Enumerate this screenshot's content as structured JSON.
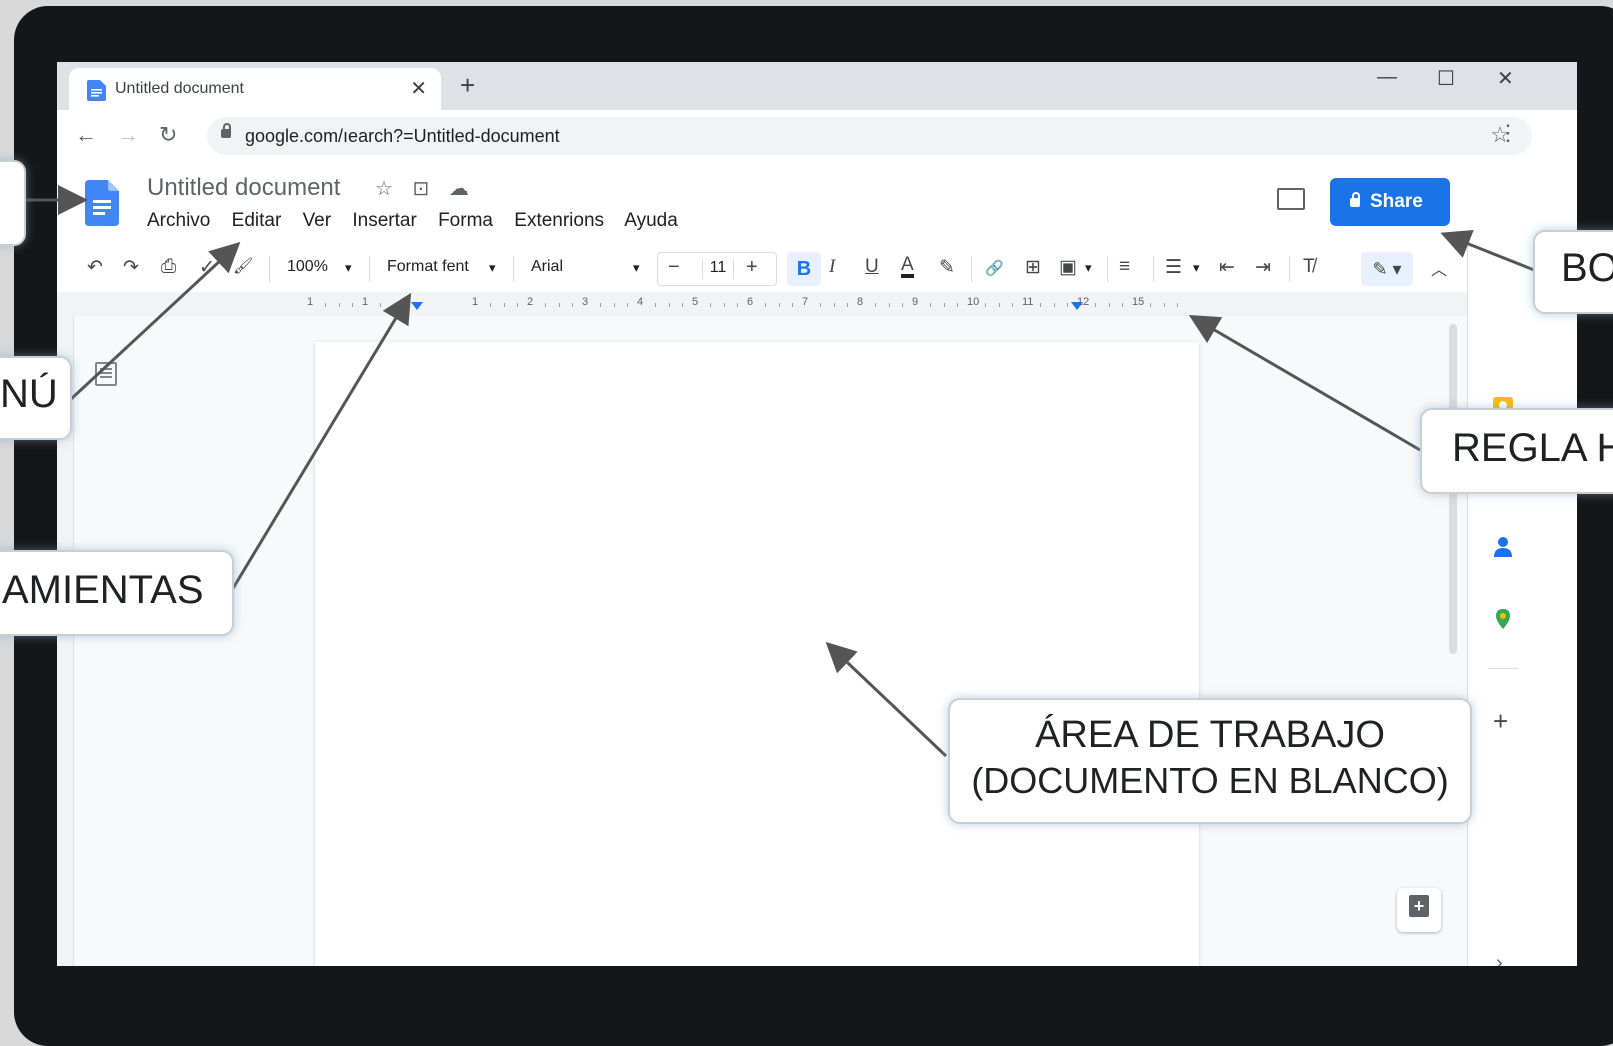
{
  "browser": {
    "tab_title": "Untitled document",
    "tab_close": "✕",
    "new_tab": "+",
    "window_controls": [
      "—",
      "☐",
      "✕"
    ],
    "url": "google.com/ıearch?=Untitled-document",
    "back": "←",
    "forward": "→",
    "reload": "↻",
    "bookmark": "☆",
    "menu": "⋮"
  },
  "docs": {
    "title": "Untitled document",
    "title_icons": [
      "☆",
      "⊡",
      "☁"
    ],
    "menu": [
      "Archivo",
      "Editar",
      "Ver",
      "Insertar",
      "Forma",
      "Extenrions",
      "Ayuda"
    ],
    "share_label": "Share"
  },
  "toolbar": {
    "undo": "↶",
    "redo": "↷",
    "print": "⎙",
    "spellcheck": "✓",
    "paint_format": "🖌",
    "zoom": "100%",
    "style": "Format fent",
    "font": "Arial",
    "font_size": "11",
    "minus": "−",
    "plus": "+",
    "bold": "B",
    "italic": "I",
    "underline": "U",
    "text_color": "A",
    "highlight": "✎",
    "link": "🔗",
    "comment": "⊞",
    "image": "▣",
    "align": "≡",
    "bullets": "☰",
    "indent_less": "⇤",
    "indent_more": "⇥",
    "clear_format": "T̸",
    "edit_mode": "✎ ▾",
    "collapse": "︿",
    "dropdown": "▾"
  },
  "ruler": {
    "numbers": [
      "1",
      "1",
      "1",
      "2",
      "3",
      "4",
      "5",
      "6",
      "7",
      "8",
      "9",
      "10",
      "11",
      "12",
      "15"
    ]
  },
  "annotations": {
    "menu": "NÚ",
    "tools": "AMIENTAS",
    "share_button": "BO",
    "ruler": "REGLA H",
    "work_area_line1": "ÁREA DE TRABAJO",
    "work_area_line2": "(DOCUMENTO EN BLANCO)"
  },
  "colors": {
    "accent": "#1a73e8",
    "docs_blue": "#4285f4",
    "keep_yellow": "#fbbc04"
  }
}
